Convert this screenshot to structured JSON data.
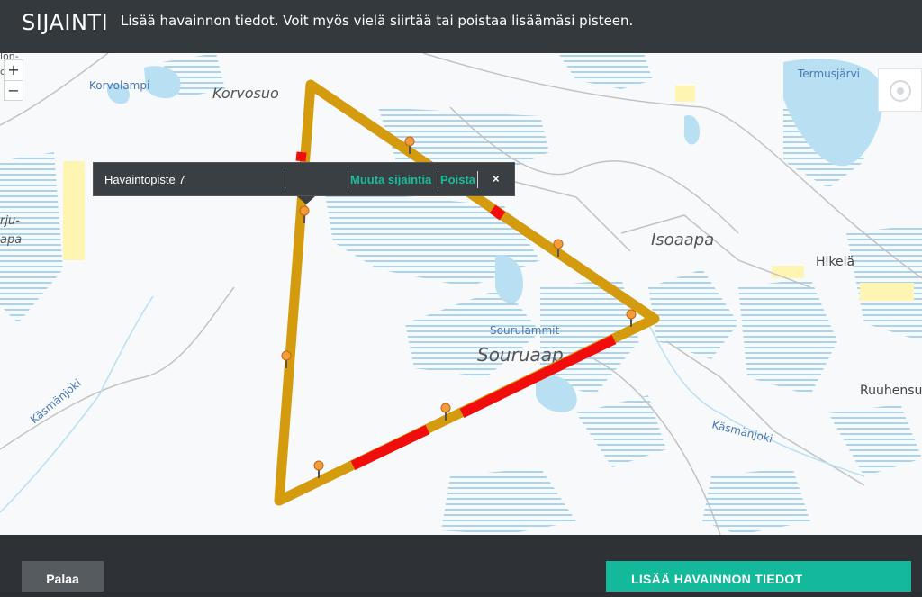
{
  "header": {
    "title": "SIJAINTI",
    "subtitle": "Lisää havainnon tiedot. Voit myös vielä siirtää tai poistaa lisäämäsi pisteen."
  },
  "map": {
    "zoom_in": "+",
    "zoom_out": "−",
    "labels": {
      "korvolampi": "Korvolampi",
      "korvosuo": "Korvosuo",
      "termusjarvi": "Termusjärvi",
      "isoaapa": "Isoaapa",
      "hikela": "Hikelä",
      "sourulammit": "Sourulammit",
      "souruaapa": "Souruaap",
      "kasmanjoki_w": "Käsmänjoki",
      "kasmanjoki_e": "Käsmänjoki",
      "ruuhensu": "Ruuhensu",
      "edge_a": "rju-",
      "edge_b": "apa",
      "edge_c": "lon-",
      "edge_d": "o"
    },
    "colors": {
      "route": "#d49b0e",
      "route_highlight": "#f20d0d",
      "water": "#b8e0f2",
      "bog_lines": "#a9d4ef",
      "road": "#bfbfbf",
      "field": "#fff5b3"
    }
  },
  "popup": {
    "point_name": "Havaintopiste 7",
    "move_label": "Muuta sijaintia",
    "delete_label": "Poista",
    "close_label": "×"
  },
  "footer": {
    "back_label": "Palaa",
    "submit_label": "LISÄÄ HAVAINNON TIEDOT"
  }
}
